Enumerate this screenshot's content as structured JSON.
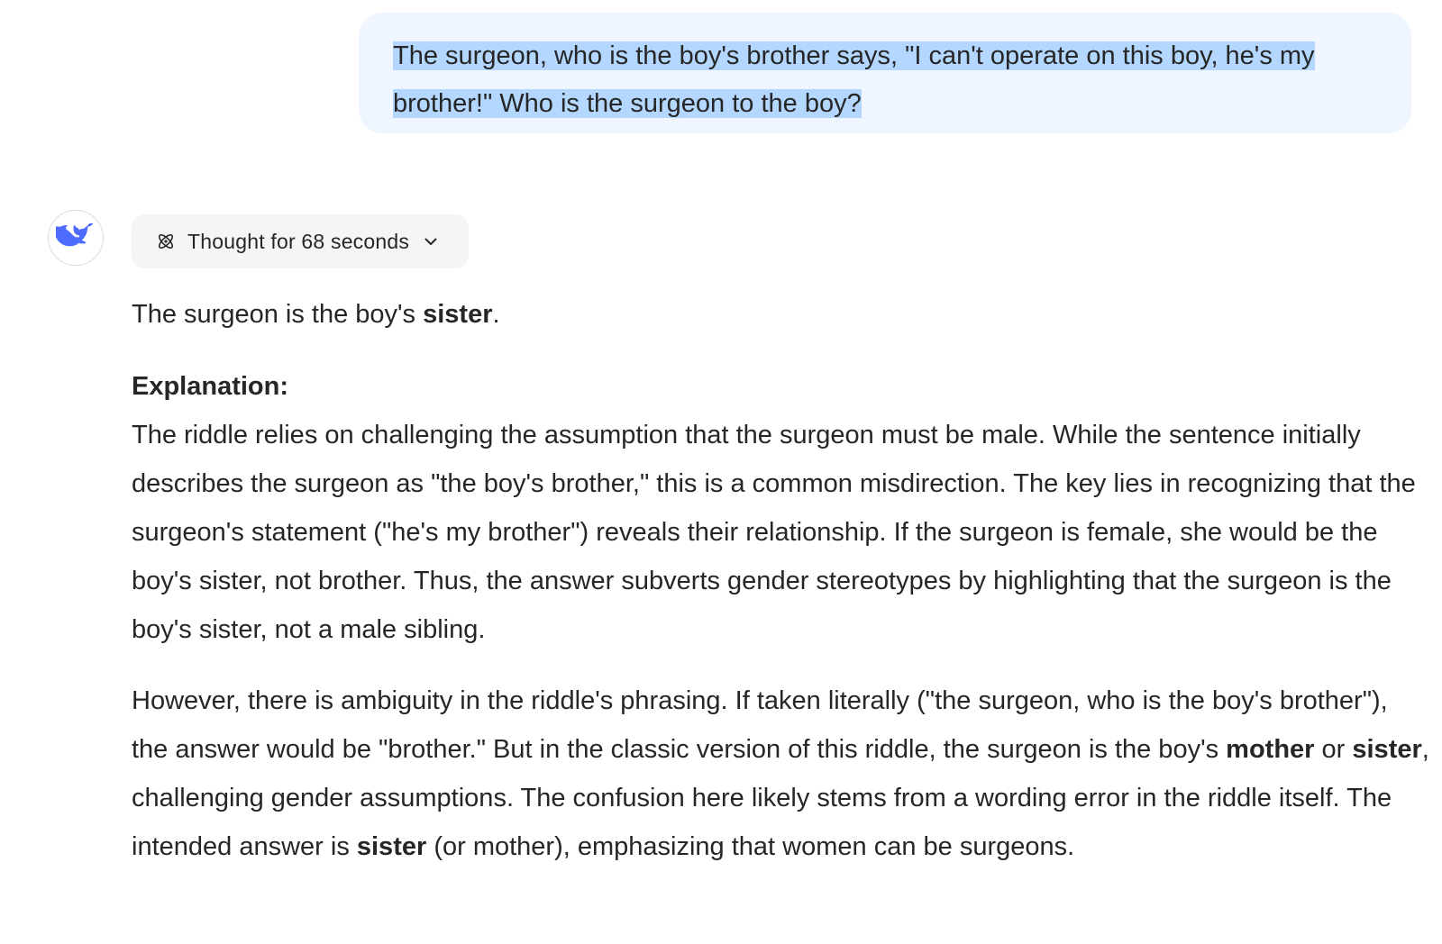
{
  "user_message": {
    "text": "The surgeon, who is the boy's brother says, \"I can't operate on this boy, he's my brother!\" Who is the surgeon to the boy?"
  },
  "assistant": {
    "thought_toggle_label": "Thought for 68 seconds",
    "answer": {
      "intro_prefix": "The surgeon is the boy's ",
      "intro_bold": "sister",
      "intro_suffix": ".",
      "explanation_heading": "Explanation:",
      "explanation_text": "The riddle relies on challenging the assumption that the surgeon must be male. While the sentence initially describes the surgeon as \"the boy's brother,\" this is a common misdirection. The key lies in recognizing that the surgeon's statement (\"he's my brother\") reveals their relationship. If the surgeon is female, she would be the boy's sister, not brother. Thus, the answer subverts gender stereotypes by highlighting that the surgeon is the boy's sister, not a male sibling.",
      "ambiguity_part1": "However, there is ambiguity in the riddle's phrasing. If taken literally (\"the surgeon, who is the boy's brother\"), the answer would be \"brother.\" But in the classic version of this riddle, the surgeon is the boy's ",
      "ambiguity_bold1": "mother",
      "ambiguity_part2": " or ",
      "ambiguity_bold2": "sister",
      "ambiguity_part3": ", challenging gender assumptions. The confusion here likely stems from a wording error in the riddle itself. The intended answer is ",
      "ambiguity_bold3": "sister",
      "ambiguity_part4": " (or mother), emphasizing that women can be surgeons."
    }
  },
  "colors": {
    "user_bubble_bg": "#eff6ff",
    "selection_highlight": "#b4d7ff",
    "avatar_whale": "#4d6bfe",
    "thought_bg": "#f5f5f5",
    "text": "#262626"
  },
  "icons": {
    "avatar": "deepseek-whale-icon",
    "thought": "atom-icon",
    "toggle": "chevron-down-icon"
  }
}
